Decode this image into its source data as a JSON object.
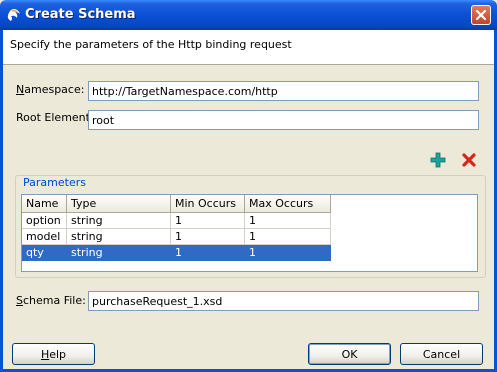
{
  "window": {
    "title": "Create Schema"
  },
  "description": "Specify the parameters of the Http binding request",
  "fields": {
    "namespace": {
      "label_mnemonic": "N",
      "label_rest": "amespace:",
      "value": "http://TargetNamespace.com/http"
    },
    "root_element": {
      "label": "Root Element:",
      "value": "root"
    },
    "schema_file": {
      "label_mnemonic": "S",
      "label_rest": "chema File:",
      "value": "purchaseRequest_1.xsd"
    }
  },
  "parameters": {
    "legend": "Parameters",
    "columns": [
      "Name",
      "Type",
      "Min Occurs",
      "Max Occurs"
    ],
    "rows": [
      {
        "name": "option",
        "type": "string",
        "min": "1",
        "max": "1"
      },
      {
        "name": "model",
        "type": "string",
        "min": "1",
        "max": "1"
      },
      {
        "name": "qty",
        "type": "string",
        "min": "1",
        "max": "1"
      }
    ],
    "selected_row": 2
  },
  "icons": {
    "title": "app-icon",
    "add": "add-plus-icon",
    "remove": "delete-x-icon",
    "close": "close-icon"
  },
  "buttons": {
    "help_mnemonic": "H",
    "help_rest": "elp",
    "ok": "OK",
    "cancel": "Cancel"
  },
  "colors": {
    "titlebar": "#0A50D8",
    "selection": "#316AC5",
    "add_icon": "#1BA39C",
    "remove_icon": "#D9261C"
  }
}
